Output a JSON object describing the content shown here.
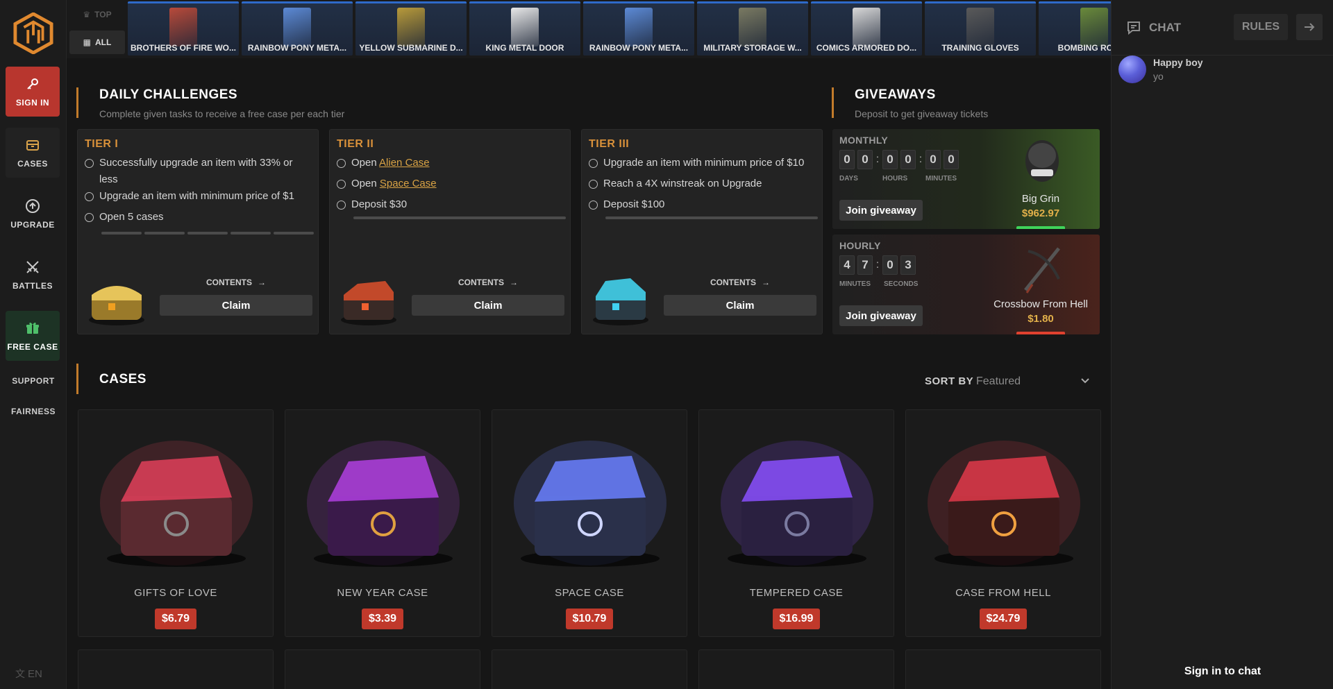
{
  "sidebar": {
    "items": [
      {
        "label": "SIGN IN"
      },
      {
        "label": "CASES"
      },
      {
        "label": "UPGRADE"
      },
      {
        "label": "BATTLES"
      },
      {
        "label": "FREE CASE"
      }
    ],
    "support": "SUPPORT",
    "fairness": "FAIRNESS",
    "language": "EN"
  },
  "strip": {
    "tab_top": "TOP",
    "tab_all": "ALL",
    "drops": [
      {
        "name": "BROTHERS OF FIRE WO...",
        "color": "#b84a3a"
      },
      {
        "name": "RAINBOW PONY META...",
        "color": "#5c8ad6"
      },
      {
        "name": "YELLOW SUBMARINE D...",
        "color": "#b89a3a"
      },
      {
        "name": "KING METAL DOOR",
        "color": "#e8e8e8"
      },
      {
        "name": "RAINBOW PONY META...",
        "color": "#5c8ad6"
      },
      {
        "name": "MILITARY STORAGE W...",
        "color": "#7a7a62"
      },
      {
        "name": "COMICS ARMORED DO...",
        "color": "#d8d8d8"
      },
      {
        "name": "TRAINING GLOVES",
        "color": "#5a5a5a"
      },
      {
        "name": "BOMBING ROADS",
        "color": "#6a8a3a"
      }
    ]
  },
  "challenges": {
    "title": "DAILY CHALLENGES",
    "subtitle": "Complete given tasks to receive a free case per each tier",
    "contents_label": "CONTENTS",
    "claim_label": "Claim",
    "tiers": [
      {
        "title": "TIER I",
        "tasks": [
          "Successfully upgrade an item with 33% or less",
          "Upgrade an item with minimum price of $1",
          "Open 5 cases"
        ]
      },
      {
        "title": "TIER II",
        "tasks": [
          {
            "prefix": "Open ",
            "link": "Alien Case"
          },
          {
            "prefix": "Open ",
            "link": "Space Case"
          },
          "Deposit $30"
        ]
      },
      {
        "title": "TIER III",
        "tasks": [
          "Upgrade an item with minimum price of $10",
          "Reach a 4X winstreak on Upgrade",
          "Deposit $100"
        ]
      }
    ]
  },
  "giveaways": {
    "title": "GIVEAWAYS",
    "subtitle": "Deposit to get giveaway tickets",
    "join_label": "Join giveaway",
    "monthly": {
      "label": "MONTHLY",
      "days": [
        "0",
        "0"
      ],
      "hours": [
        "0",
        "0"
      ],
      "minutes": [
        "0",
        "0"
      ],
      "units": [
        "DAYS",
        "HOURS",
        "MINUTES"
      ],
      "prize_name": "Big Grin",
      "prize_price": "$962.97"
    },
    "hourly": {
      "label": "HOURLY",
      "minutes": [
        "4",
        "7"
      ],
      "seconds": [
        "0",
        "3"
      ],
      "units": [
        "MINUTES",
        "SECONDS"
      ],
      "prize_name": "Crossbow From Hell",
      "prize_price": "$1.80"
    }
  },
  "cases": {
    "title": "CASES",
    "sort_label": "SORT BY",
    "sort_value": "Featured",
    "items": [
      {
        "name": "GIFTS OF LOVE",
        "price": "$6.79"
      },
      {
        "name": "NEW YEAR CASE",
        "price": "$3.39"
      },
      {
        "name": "SPACE CASE",
        "price": "$10.79"
      },
      {
        "name": "TEMPERED CASE",
        "price": "$16.99"
      },
      {
        "name": "CASE FROM HELL",
        "price": "$24.79"
      }
    ]
  },
  "chat": {
    "title": "CHAT",
    "rules_label": "RULES",
    "messages": [
      {
        "user": "Happy boy",
        "text": "yo"
      }
    ],
    "signin_label": "Sign in to chat"
  }
}
